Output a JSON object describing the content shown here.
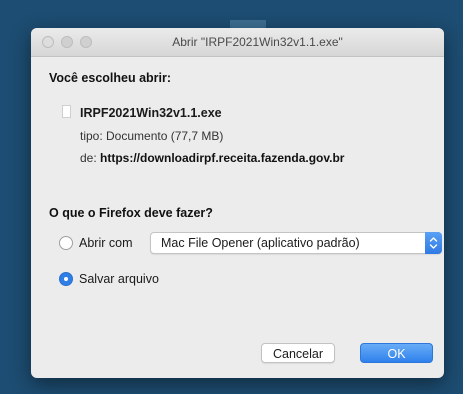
{
  "dialog": {
    "title": "Abrir \"IRPF2021Win32v1.1.exe\"",
    "heading": "Você escolheu abrir:",
    "file": {
      "name": "IRPF2021Win32v1.1.exe",
      "type_label": "tipo: Documento (77,7 MB)",
      "from_prefix": "de: ",
      "from_url": "https://downloadirpf.receita.fazenda.gov.br",
      "icon": "document-icon"
    },
    "question": "O que o Firefox deve fazer?",
    "options": {
      "open_with_label": "Abrir com",
      "open_with_app": "Mac File Opener (aplicativo padrão)",
      "save_label": "Salvar arquivo",
      "selected": "save"
    },
    "buttons": {
      "cancel": "Cancelar",
      "ok": "OK"
    }
  },
  "colors": {
    "background": "#1d4d72",
    "accent": "#2f7fe6",
    "dialog_bg": "#ececec"
  }
}
